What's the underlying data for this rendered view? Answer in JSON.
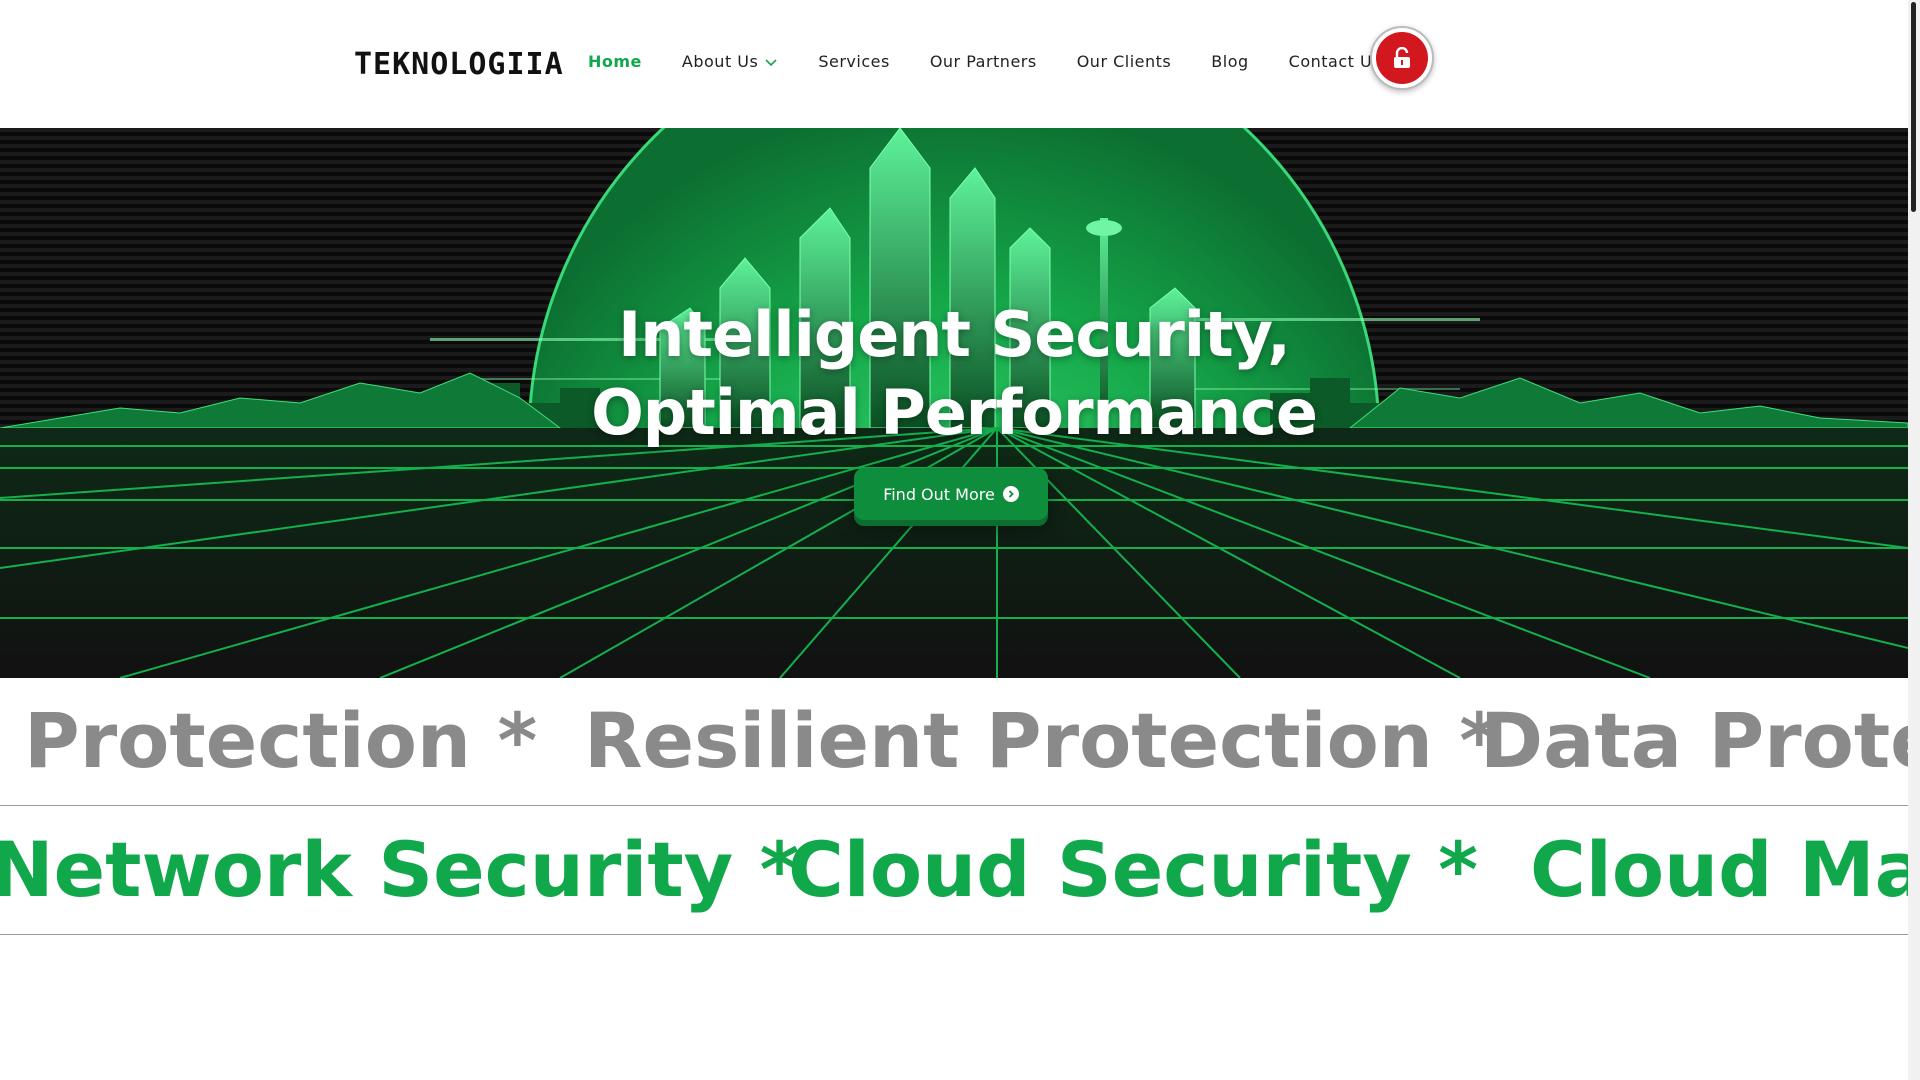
{
  "header": {
    "logo_text": "TEKNOLOGIIA",
    "nav": [
      {
        "label": "Home",
        "active": true
      },
      {
        "label": "About Us",
        "has_dropdown": true
      },
      {
        "label": "Services"
      },
      {
        "label": "Our Partners"
      },
      {
        "label": "Our Clients"
      },
      {
        "label": "Blog"
      },
      {
        "label": "Contact Us"
      }
    ],
    "lock_icon": "lock-open-icon",
    "lock_color": "#d2181e"
  },
  "hero": {
    "title_line1": "Intelligent Security,",
    "title_line2": "Optimal Performance",
    "button_label": "Find Out More",
    "button_icon": "chevron-right-circle-icon",
    "accent": "#10a84a"
  },
  "marquee_gray": {
    "items": [
      "Protection *",
      "Resilient Protection *",
      "Data Protec"
    ]
  },
  "marquee_green": {
    "items": [
      "Network Security *",
      "Cloud Security *",
      "Cloud Mar"
    ]
  },
  "colors": {
    "brand_green": "#10a84a",
    "dark_bg": "#111111",
    "gray_text": "#8a8a8a"
  }
}
